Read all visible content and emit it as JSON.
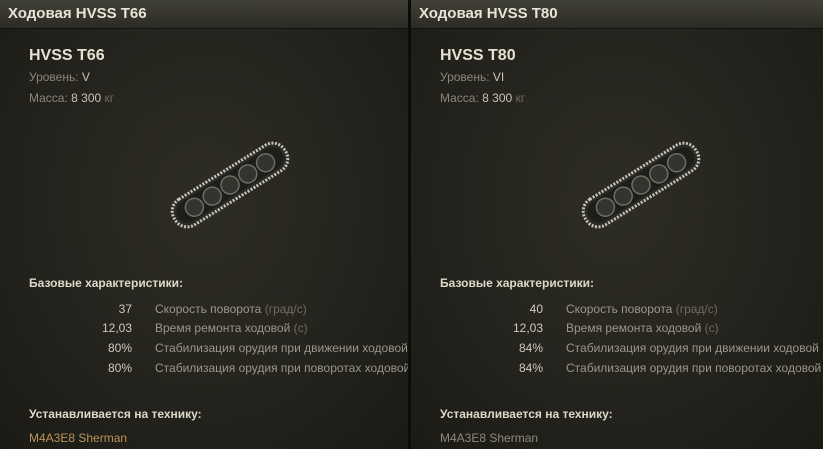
{
  "panels": [
    {
      "title": "Ходовая HVSS T66",
      "name": "HVSS T66",
      "level_label": "Уровень:",
      "level_value": "V",
      "mass_label": "Масса:",
      "mass_value": "8 300",
      "mass_unit": "кг",
      "base_header": "Базовые характеристики:",
      "stats": [
        {
          "value": "37",
          "label": "Скорость поворота",
          "unit": "(град/с)"
        },
        {
          "value": "12,03",
          "label": "Время ремонта ходовой",
          "unit": "(с)"
        },
        {
          "value": "80%",
          "label": "Стабилизация орудия при движении ходовой",
          "unit": ""
        },
        {
          "value": "80%",
          "label": "Стабилизация орудия при поворотах ходовой",
          "unit": ""
        }
      ],
      "install_header": "Устанавливается на технику:",
      "vehicles": [
        "M4A3E8 Sherman"
      ],
      "vehicle_color": "#b9935a"
    },
    {
      "title": "Ходовая HVSS T80",
      "name": "HVSS T80",
      "level_label": "Уровень:",
      "level_value": "VI",
      "mass_label": "Масса:",
      "mass_value": "8 300",
      "mass_unit": "кг",
      "base_header": "Базовые характеристики:",
      "stats": [
        {
          "value": "40",
          "label": "Скорость поворота",
          "unit": "(град/с)"
        },
        {
          "value": "12,03",
          "label": "Время ремонта ходовой",
          "unit": "(с)"
        },
        {
          "value": "84%",
          "label": "Стабилизация орудия при движении ходовой",
          "unit": ""
        },
        {
          "value": "84%",
          "label": "Стабилизация орудия при поворотах ходовой",
          "unit": ""
        }
      ],
      "install_header": "Устанавливается на технику:",
      "vehicles": [
        "M4A3E8 Sherman"
      ],
      "vehicle_color": "#8c897c"
    }
  ],
  "icons": {
    "module": "track-suspension-icon"
  }
}
